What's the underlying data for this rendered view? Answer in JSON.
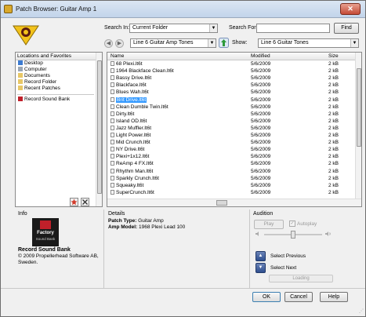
{
  "window": {
    "title": "Patch Browser: Guitar Amp 1",
    "close": "✕"
  },
  "search": {
    "search_in_label": "Search In:",
    "search_in_value": "Current Folder",
    "search_for_label": "Search For:",
    "search_for_value": "",
    "find_label": "Find",
    "path_value": "Line 6 Guitar Amp Tones",
    "show_label": "Show:",
    "show_value": "Line 6 Guitar Tones"
  },
  "locations": {
    "header": "Locations and Favorites",
    "items": [
      "Desktop",
      "Computer",
      "Documents",
      "Record Folder",
      "Recent Patches",
      "Record Sound Bank"
    ]
  },
  "files": {
    "col_name": "Name",
    "col_modified": "Modified",
    "col_size": "Size",
    "rows": [
      {
        "name": "68 Plexi.lt6t",
        "modified": "5/6/2009",
        "size": "2 kB"
      },
      {
        "name": "1964 Blackface Clean.lt6t",
        "modified": "5/6/2009",
        "size": "2 kB"
      },
      {
        "name": "Bassy Drive.lt6t",
        "modified": "5/6/2009",
        "size": "2 kB"
      },
      {
        "name": "Blackface.lt6t",
        "modified": "5/6/2009",
        "size": "2 kB"
      },
      {
        "name": "Blues Wah.lt6t",
        "modified": "5/6/2009",
        "size": "2 kB"
      },
      {
        "name": "Brit Drive.lt6t",
        "modified": "5/6/2009",
        "size": "2 kB"
      },
      {
        "name": "Clean Dumble Twin.lt6t",
        "modified": "5/6/2009",
        "size": "2 kB"
      },
      {
        "name": "Dirty.lt6t",
        "modified": "5/6/2009",
        "size": "2 kB"
      },
      {
        "name": "Island OD.lt6t",
        "modified": "5/6/2009",
        "size": "2 kB"
      },
      {
        "name": "Jazz Muffler.lt6t",
        "modified": "5/6/2009",
        "size": "2 kB"
      },
      {
        "name": "Light Power.lt6t",
        "modified": "5/6/2009",
        "size": "2 kB"
      },
      {
        "name": "Mid Crunch.lt6t",
        "modified": "5/6/2009",
        "size": "2 kB"
      },
      {
        "name": "NY Drive.lt6t",
        "modified": "5/6/2009",
        "size": "2 kB"
      },
      {
        "name": "Plexi+1x12.lt6t",
        "modified": "5/6/2009",
        "size": "2 kB"
      },
      {
        "name": "ReAmp 4 FX.lt6t",
        "modified": "5/6/2009",
        "size": "2 kB"
      },
      {
        "name": "Rhythm Man.lt6t",
        "modified": "5/6/2009",
        "size": "2 kB"
      },
      {
        "name": "Sparkly Crunch.lt6t",
        "modified": "5/6/2009",
        "size": "2 kB"
      },
      {
        "name": "Squeaky.lt6t",
        "modified": "5/6/2009",
        "size": "2 kB"
      },
      {
        "name": "SuperCrunch.lt6t",
        "modified": "5/6/2009",
        "size": "2 kB"
      }
    ]
  },
  "info": {
    "label": "Info",
    "bank_line1": "Factory",
    "bank_line2": "Sound Bank",
    "bank_name": "Record Sound Bank",
    "copyright": "© 2009 Propellerhead Software AB, Sweden."
  },
  "details": {
    "label": "Details",
    "patch_type_key": "Patch Type:",
    "patch_type_val": "Guitar Amp",
    "amp_model_key": "Amp Model:",
    "amp_model_val": "1968 Plexi Lead 100"
  },
  "audition": {
    "label": "Audition",
    "play": "Play",
    "autoplay": "Autoplay",
    "select_previous": "Select Previous",
    "select_next": "Select Next",
    "loading": "Loading"
  },
  "footer": {
    "ok": "OK",
    "cancel": "Cancel",
    "help": "Help"
  }
}
